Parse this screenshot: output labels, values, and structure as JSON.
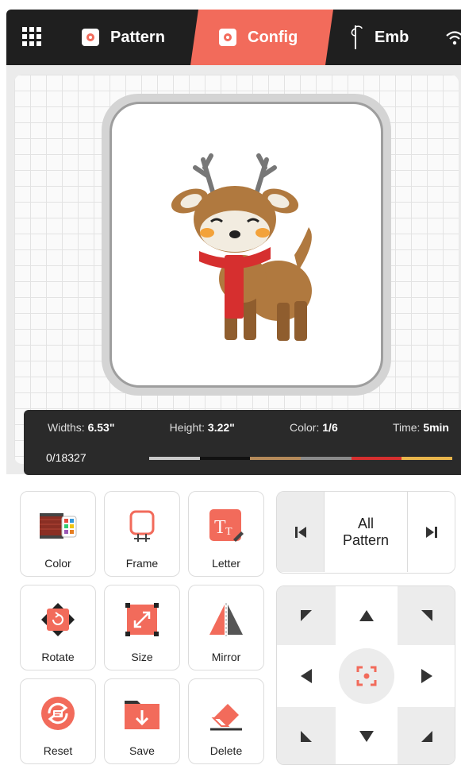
{
  "header": {
    "tabs": [
      {
        "label": "Pattern",
        "icon": "pattern-icon"
      },
      {
        "label": "Config",
        "icon": "config-icon",
        "active": true
      },
      {
        "label": "Emb",
        "icon": "needle-icon"
      }
    ],
    "accent_color": "#f26b5b",
    "bar_color": "#1f1f1f"
  },
  "preview": {
    "widths_label": "Widths:",
    "widths_value": "6.53\"",
    "height_label": "Height:",
    "height_value": "3.22\"",
    "color_label": "Color:",
    "color_value": "1/6",
    "time_label": "Time:",
    "time_value": "5min",
    "stitch_count": "0/18327",
    "thread_colors": [
      "#c9c9c9",
      "#111111",
      "#b58a5a",
      "#8a8a8a",
      "#d62f2f",
      "#e8b54c"
    ]
  },
  "tools": [
    {
      "label": "Color",
      "icon": "color-thread-icon"
    },
    {
      "label": "Frame",
      "icon": "frame-icon"
    },
    {
      "label": "Letter",
      "icon": "letter-icon"
    },
    {
      "label": "Rotate",
      "icon": "rotate-icon"
    },
    {
      "label": "Size",
      "icon": "size-icon"
    },
    {
      "label": "Mirror",
      "icon": "mirror-icon"
    },
    {
      "label": "Reset",
      "icon": "reset-icon"
    },
    {
      "label": "Save",
      "icon": "save-icon"
    },
    {
      "label": "Delete",
      "icon": "eraser-icon"
    }
  ],
  "selector": {
    "line1": "All",
    "line2": "Pattern"
  }
}
